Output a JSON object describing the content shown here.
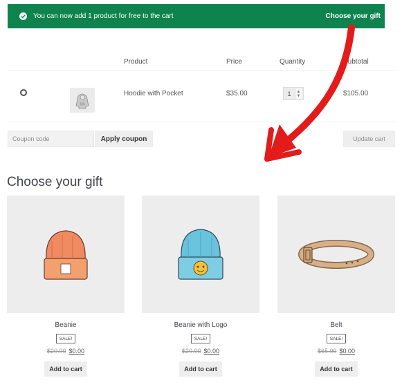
{
  "notice": {
    "message": "You can now add 1 product for free to the cart",
    "link": "Choose your gift"
  },
  "cart": {
    "headers": {
      "product": "Product",
      "price": "Price",
      "quantity": "Quantity",
      "subtotal": "Subtotal"
    },
    "row": {
      "name": "Hoodie with Pocket",
      "price": "$35.00",
      "quantity": "1",
      "subtotal": "$105.00"
    },
    "coupon_placeholder": "Coupon code",
    "apply_label": "Apply coupon",
    "update_label": "Update cart"
  },
  "gifts": {
    "title": "Choose your gift",
    "products": [
      {
        "name": "Beanie",
        "badge": "SALE!",
        "old_price": "$20.00",
        "new_price": "$0.00",
        "button": "Add to cart"
      },
      {
        "name": "Beanie with Logo",
        "badge": "SALE!",
        "old_price": "$20.00",
        "new_price": "$0.00",
        "button": "Add to cart"
      },
      {
        "name": "Belt",
        "badge": "SALE!",
        "old_price": "$65.00",
        "new_price": "$0.00",
        "button": "Add to cart"
      }
    ]
  },
  "colors": {
    "notice_bg": "#0f834d",
    "arrow": "#e31b1b",
    "placeholder_bg": "#ededed"
  }
}
